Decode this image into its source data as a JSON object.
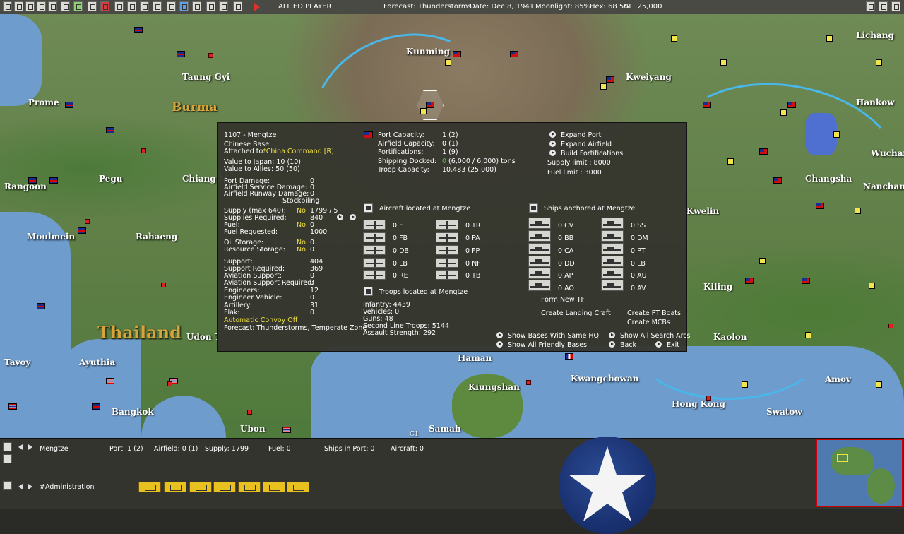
{
  "topbar": {
    "player": "ALLIED PLAYER",
    "forecast": "Forecast: Thunderstorms",
    "date": "Date: Dec 8, 1941",
    "moonlight": "Moonlight: 85%",
    "hex": "Hex: 68 50",
    "sl": "SL: 25,000"
  },
  "map": {
    "cities": [
      "Kunming",
      "Kweiyang",
      "Taung Gyi",
      "Prome",
      "Pegu",
      "Rangoon",
      "Chiang M",
      "Moulmein",
      "Rahaeng",
      "Udon T",
      "Tavoy",
      "Ayuthia",
      "Bangkok",
      "Ubon",
      "Haman",
      "Kiungshan",
      "Kwangchowan",
      "Hong Kong",
      "Samah",
      "Swatow",
      "Amov",
      "Kaolon",
      "Kwelin",
      "Hankow",
      "Changsha",
      "Nanchang",
      "Wuchang",
      "Lichang",
      "Kiling"
    ],
    "countries": [
      "Burma",
      "Thailand"
    ],
    "hex_label": "C1"
  },
  "base": {
    "title": "1107 - Mengtze",
    "type": "Chinese Base",
    "attached_label": "Attached to:",
    "attached_value": "*China Command [R]",
    "value_japan": "Value to Japan: 10 (10)",
    "value_allies": "Value to Allies: 50 (50)",
    "damage": [
      {
        "label": "Port Damage:",
        "value": "0"
      },
      {
        "label": "Airfield Service Damage:",
        "value": "0"
      },
      {
        "label": "Airfield Runway Damage:",
        "value": "0"
      }
    ],
    "stockpiling": "Stockpiling",
    "supply_label": "Supply (max 640):",
    "supply_flag": "No",
    "supply_value": "1799 / 5",
    "supplies_req_label": "Supplies Required:",
    "supplies_req_value": "840",
    "fuel_label": "Fuel:",
    "fuel_flag": "No",
    "fuel_value": "0",
    "fuel_req_label": "Fuel Requested:",
    "fuel_req_value": "1000",
    "oil_label": "Oil Storage:",
    "oil_flag": "No",
    "oil_value": "0",
    "resource_label": "Resource Storage:",
    "resource_flag": "No",
    "resource_value": "0",
    "support": [
      {
        "label": "Support:",
        "value": "404"
      },
      {
        "label": "Support Required:",
        "value": "369"
      },
      {
        "label": "Aviation Support:",
        "value": "0"
      },
      {
        "label": "Aviation Support Required:",
        "value": "0"
      },
      {
        "label": "Engineers:",
        "value": "12"
      },
      {
        "label": "Engineer Vehicle:",
        "value": "0"
      },
      {
        "label": "Artillery:",
        "value": "31"
      },
      {
        "label": "Flak:",
        "value": "0"
      }
    ],
    "convoy": "Automatic Convoy Off",
    "forecast": "Forecast: Thunderstorms, Temperate Zone"
  },
  "port": {
    "rows": [
      {
        "label": "Port Capacity:",
        "value": "1 (2)"
      },
      {
        "label": "Airfield Capacity:",
        "value": "0 (1)"
      },
      {
        "label": "Fortifications:",
        "value": "1 (9)"
      }
    ],
    "shipping_label": "Shipping Docked:",
    "shipping_zero": "0",
    "shipping_value": "(6,000 / 6,000) tons",
    "troop_label": "Troop Capacity:",
    "troop_value": "10,483   (25,000)"
  },
  "actions": {
    "expand_port": "Expand Port",
    "expand_airfield": "Expand Airfield",
    "build_fort": "Build Fortifications",
    "supply_limit": "Supply limit : 8000",
    "fuel_limit": "Fuel limit : 3000"
  },
  "aircraft": {
    "header": "Aircraft located at Mengtze",
    "left": [
      "0 F",
      "0 FB",
      "0 DB",
      "0 LB",
      "0 RE"
    ],
    "right": [
      "0 TR",
      "0 PA",
      "0 FP",
      "0 NF",
      "0 TB"
    ]
  },
  "ships": {
    "header": "Ships anchored at Mengtze",
    "left": [
      "0 CV",
      "0 BB",
      "0 CA",
      "0 DD",
      "0 AP",
      "0 AO"
    ],
    "right": [
      "0 SS",
      "0 DM",
      "0 PT",
      "0 LB",
      "0 AU",
      "0 AV"
    ],
    "form_tf": "Form New TF",
    "landing_craft": "Create Landing Craft",
    "pt_boats": "Create PT Boats",
    "mcbs": "Create MCBs"
  },
  "troops": {
    "header": "Troops located at Mengtze",
    "lines": [
      "Infantry: 4439",
      "Vehicles: 0",
      "Guns: 48",
      "Second Line Troops: 5144",
      "Assault Strength: 292"
    ]
  },
  "nav": {
    "show_same_hq": "Show Bases With Same HQ",
    "show_friendly": "Show All Friendly Bases",
    "show_search": "Show All Search Arcs",
    "back": "Back",
    "exit": "Exit"
  },
  "bottombar": {
    "base_name": "Mengtze",
    "port": "Port: 1 (2)",
    "airfield": "Airfield: 0 (1)",
    "supply": "Supply: 1799",
    "fuel": "Fuel: 0",
    "ships": "Ships in Port: 0",
    "aircraft": "Aircraft: 0",
    "admin": "#Administration"
  },
  "colors": {
    "accent_yellow": "#f0e040",
    "accent_green": "#3ed04a",
    "panel": "#34342e"
  }
}
